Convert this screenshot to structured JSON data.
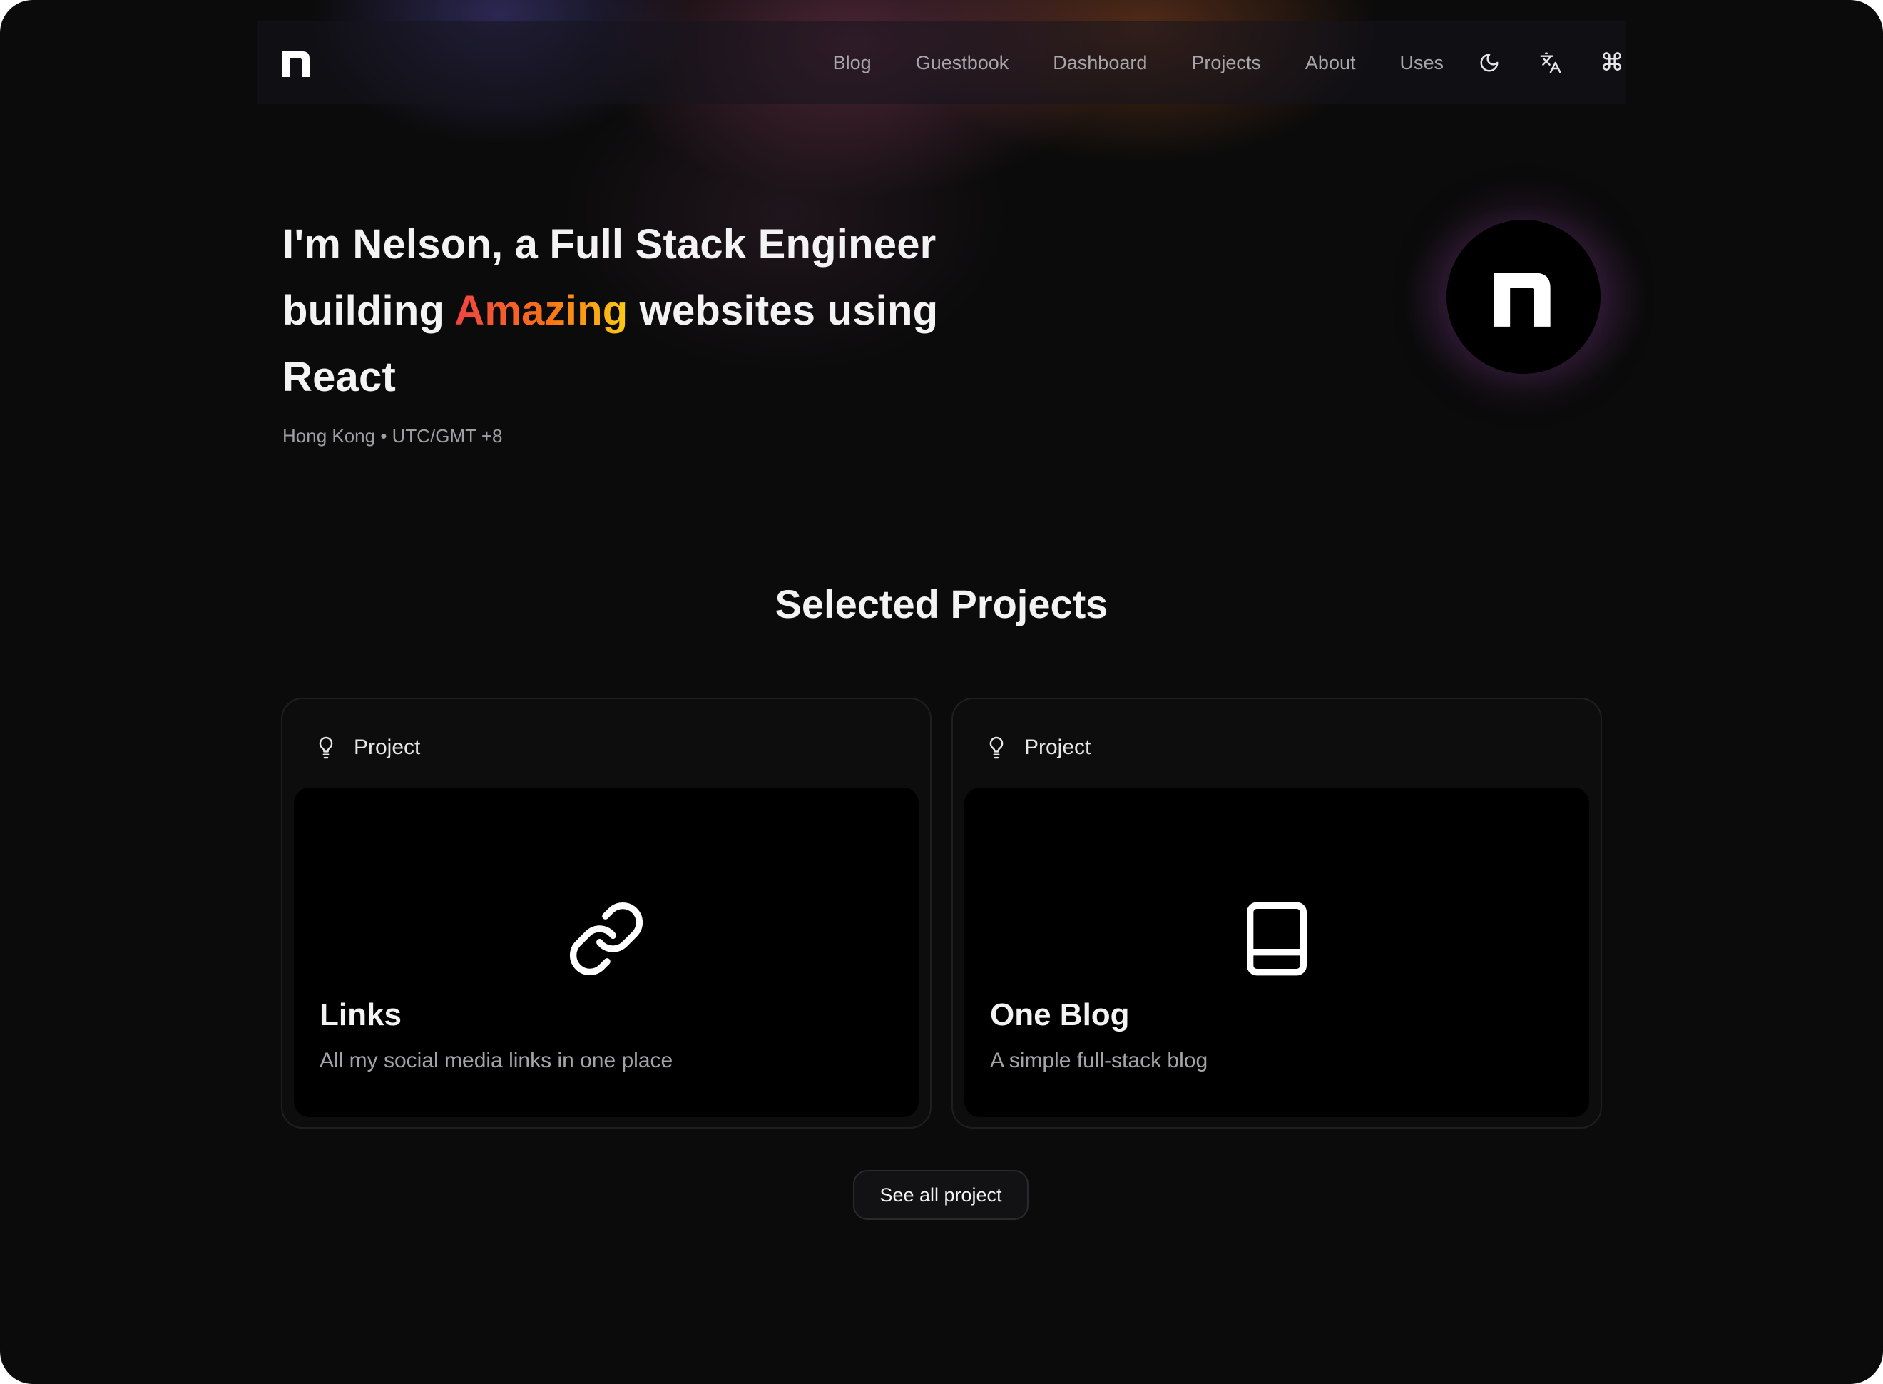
{
  "header": {
    "logo_icon": "n-logo-icon",
    "nav": [
      {
        "label": "Blog"
      },
      {
        "label": "Guestbook"
      },
      {
        "label": "Dashboard"
      },
      {
        "label": "Projects"
      },
      {
        "label": "About"
      },
      {
        "label": "Uses"
      }
    ],
    "icons": [
      "moon-icon",
      "translate-icon",
      "command-icon"
    ],
    "command_glyph": "⌘"
  },
  "hero": {
    "title_prefix": "I'm Nelson, a Full Stack Engineer building ",
    "title_highlight": "Amazing",
    "title_suffix": " websites using React",
    "location": "Hong Kong • UTC/GMT +8",
    "avatar_icon": "n-logo-icon",
    "highlight_gradient": [
      "#ef4444",
      "#f97316",
      "#facc15"
    ]
  },
  "projects": {
    "title": "Selected Projects",
    "cards": [
      {
        "label": "Project",
        "label_icon": "lightbulb-icon",
        "icon": "link-icon",
        "name": "Links",
        "description": "All my social media links in one place"
      },
      {
        "label": "Project",
        "label_icon": "lightbulb-icon",
        "icon": "book-icon",
        "name": "One Blog",
        "description": "A simple full-stack blog"
      }
    ],
    "see_all_label": "See all project"
  },
  "colors": {
    "background": "#0b0b0b",
    "card_background": "#0d0d0e",
    "card_inner": "#000000",
    "muted_text": "#a4a4a8"
  }
}
